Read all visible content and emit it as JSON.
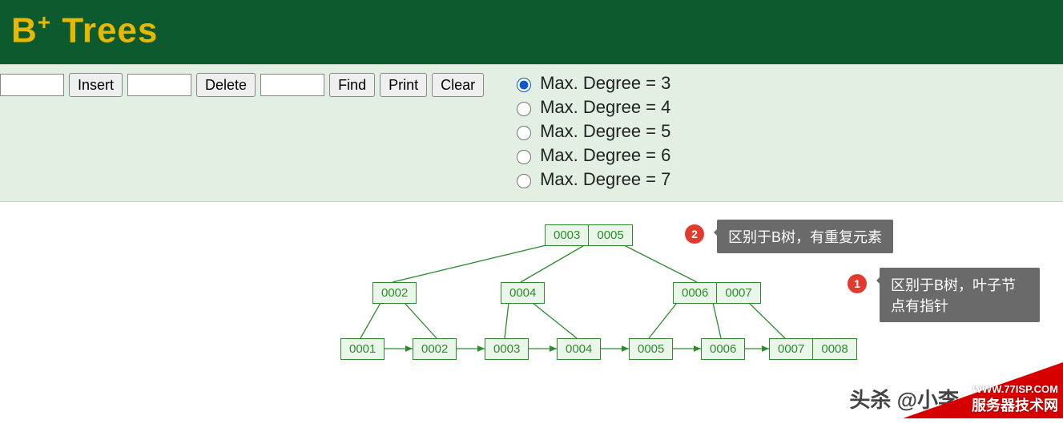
{
  "header": {
    "title_pre": "B",
    "title_sup": "+",
    "title_post": " Trees"
  },
  "toolbar": {
    "insert_label": "Insert",
    "delete_label": "Delete",
    "find_label": "Find",
    "print_label": "Print",
    "clear_label": "Clear"
  },
  "degree_options": [
    {
      "label": "Max. Degree = 3",
      "checked": true
    },
    {
      "label": "Max. Degree = 4",
      "checked": false
    },
    {
      "label": "Max. Degree = 5",
      "checked": false
    },
    {
      "label": "Max. Degree = 6",
      "checked": false
    },
    {
      "label": "Max. Degree = 7",
      "checked": false
    }
  ],
  "tree": {
    "root": [
      "0003",
      "0005"
    ],
    "mid": [
      [
        "0002"
      ],
      [
        "0004"
      ],
      [
        "0006",
        "0007"
      ]
    ],
    "leaves": [
      [
        "0001"
      ],
      [
        "0002"
      ],
      [
        "0003"
      ],
      [
        "0004"
      ],
      [
        "0005"
      ],
      [
        "0006"
      ],
      [
        "0007",
        "0008"
      ]
    ]
  },
  "annotations": {
    "a2": {
      "num": "2",
      "text": "区别于B树，有重复元素"
    },
    "a1": {
      "num": "1",
      "text": "区别于B树，叶子节点有指针"
    }
  },
  "watermark": "头杀 @小李",
  "corner": {
    "line1": "WWW.77ISP.COM",
    "line2": "服务器技术网"
  }
}
